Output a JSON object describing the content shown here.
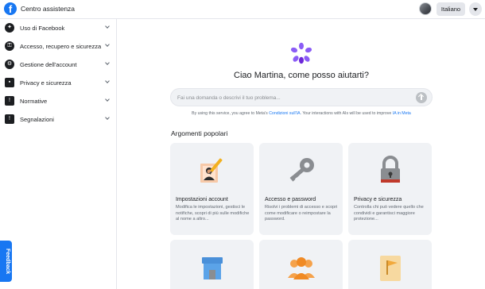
{
  "header": {
    "title": "Centro assistenza",
    "language": "Italiano",
    "logo_icon": "facebook-logo-icon",
    "menu_icon": "caret-down-icon"
  },
  "sidebar": {
    "items": [
      {
        "label": "Uso di Facebook",
        "icon": "compass-icon"
      },
      {
        "label": "Accesso, recupero e sicurezza",
        "icon": "key-icon"
      },
      {
        "label": "Gestione dell'account",
        "icon": "gear-icon"
      },
      {
        "label": "Privacy e sicurezza",
        "icon": "lock-icon"
      },
      {
        "label": "Normative",
        "icon": "alert-icon"
      },
      {
        "label": "Segnalazioni",
        "icon": "flag-icon"
      }
    ],
    "feedback": "Feedback"
  },
  "main": {
    "greeting": "Ciao Martina, come posso aiutarti?",
    "search_placeholder": "Fai una domanda o descrivi il tuo problema...",
    "disclaimer": {
      "prefix": "By using this service, you agree to Meta's",
      "terms_link": "Condizioni sull'IA",
      "middle": ". Your interactions with AIs will be used to improve",
      "ai_link": "IA in Meta"
    },
    "section_title": "Argomenti popolari",
    "cards": [
      {
        "title": "Impostazioni account",
        "desc": "Modifica le impostazioni, gestisci le notifiche, scopri di più sulle modifiche al nome a altro...",
        "icon": "profile-edit-icon"
      },
      {
        "title": "Accesso e password",
        "desc": "Risolvi i problemi di accesso e scopri come modificare o reimpostare la password.",
        "icon": "key-icon"
      },
      {
        "title": "Privacy e sicurezza",
        "desc": "Controlla chi può vedere quello che condividi e garantisci maggiore protezione...",
        "icon": "padlock-icon"
      },
      {
        "title": "",
        "desc": "",
        "icon": "marketplace-icon"
      },
      {
        "title": "",
        "desc": "",
        "icon": "groups-icon"
      },
      {
        "title": "",
        "desc": "",
        "icon": "pages-icon"
      }
    ]
  },
  "colors": {
    "brand": "#1877f2",
    "meta_ai": "#8b5cf6",
    "card_bg": "#f0f2f5"
  }
}
